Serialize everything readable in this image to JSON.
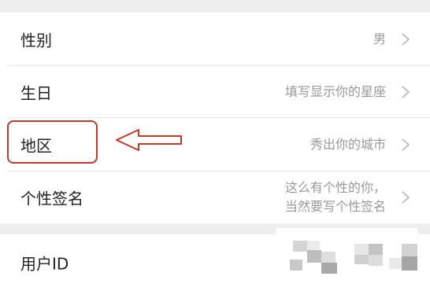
{
  "profile": {
    "rows": [
      {
        "label": "性别",
        "value": "男"
      },
      {
        "label": "生日",
        "value": "填写显示你的星座"
      },
      {
        "label": "地区",
        "value": "秀出你的城市"
      },
      {
        "label": "个性签名",
        "value_lines": [
          "这么有个性的你，",
          "当然要写个性签名"
        ]
      },
      {
        "label": "用户ID"
      }
    ]
  },
  "icons": {
    "row_chevron": "chevron-right-icon",
    "annotation": "left-arrow-outline-icon"
  },
  "colors": {
    "highlight": "#c0392b",
    "label_text": "#222222",
    "value_text": "#999999",
    "separator": "#e8e8e8",
    "section_gap": "#eeeeee"
  }
}
